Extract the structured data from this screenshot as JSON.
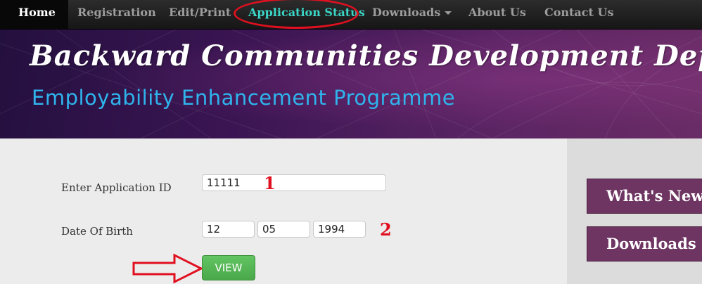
{
  "nav": {
    "items": [
      {
        "label": "Home"
      },
      {
        "label": "Registration"
      },
      {
        "label": "Edit/Print"
      },
      {
        "label": "Application Status"
      },
      {
        "label": "Downloads"
      },
      {
        "label": "About Us"
      },
      {
        "label": "Contact Us"
      }
    ],
    "active_color": "#3bd6c6"
  },
  "banner": {
    "title": "Backward Communities Development Department",
    "subtitle": "Employability Enhancement Programme"
  },
  "form": {
    "app_id_label": "Enter Application ID",
    "app_id_value": "11111",
    "dob_label": "Date Of Birth",
    "dob_day": "12",
    "dob_month": "05",
    "dob_year": "1994",
    "view_label": "VIEW"
  },
  "annotations": {
    "step1": "1",
    "step2": "2",
    "color": "#e01020"
  },
  "sidebar": {
    "whats_new_label": "What's New",
    "downloads_label": "Downloads"
  }
}
